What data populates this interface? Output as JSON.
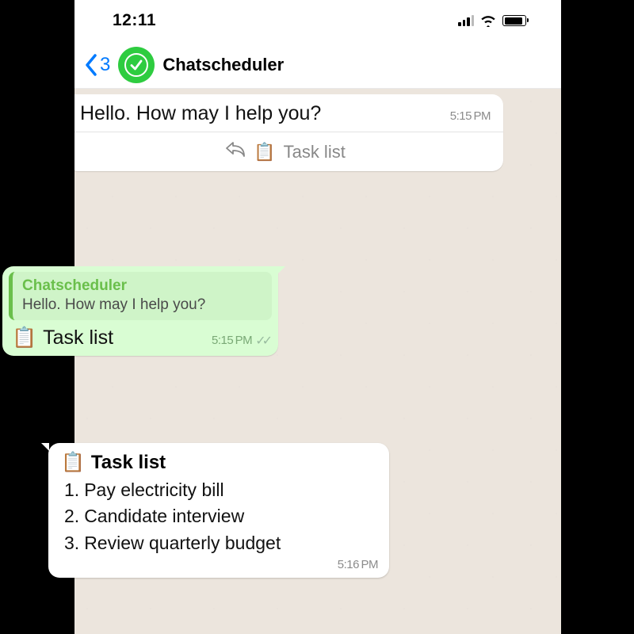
{
  "status": {
    "time": "12:11"
  },
  "header": {
    "back_count": "3",
    "chat_title": "Chatscheduler"
  },
  "msg1": {
    "text": "Hello. How may I help you?",
    "time": "5:15 PM",
    "reply_action_label": "Task list",
    "reply_action_icon": "📋"
  },
  "reply_out": {
    "quote_name": "Chatscheduler",
    "quote_text": "Hello. How may I help you?",
    "body_icon": "📋",
    "body_text": "Task list",
    "time": "5:15 PM"
  },
  "task_list": {
    "head_icon": "📋",
    "head_text": "Task list",
    "items": [
      {
        "num": "1.",
        "text": "Pay electricity bill"
      },
      {
        "num": "2.",
        "text": "Candidate interview"
      },
      {
        "num": "3.",
        "text": "Review quarterly budget"
      }
    ],
    "time": "5:16 PM"
  }
}
